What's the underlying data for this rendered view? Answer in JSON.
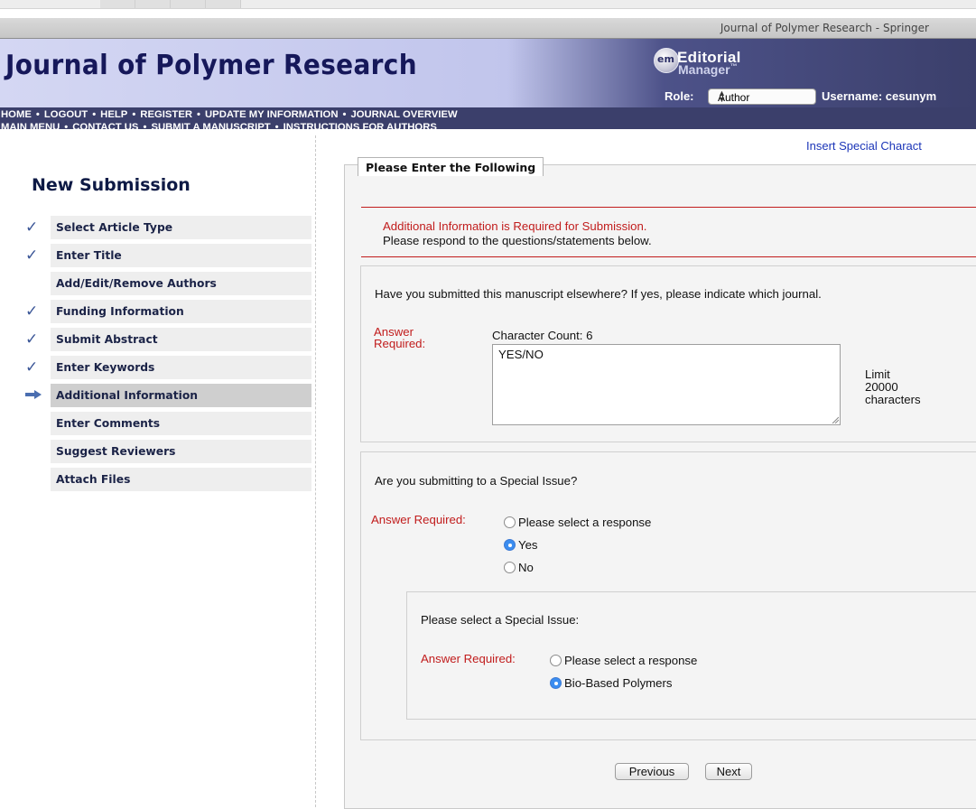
{
  "browser": {
    "site_name": "Journal of Polymer Research - Springer"
  },
  "header": {
    "journal_title": "Journal of Polymer Research",
    "logo": {
      "em": "em",
      "editorial": "Editorial",
      "manager": "Manager"
    },
    "nav_line1": [
      "HOME",
      "LOGOUT",
      "HELP",
      "REGISTER",
      "UPDATE MY INFORMATION",
      "JOURNAL OVERVIEW"
    ],
    "nav_line2": [
      "MAIN MENU",
      "CONTACT US",
      "SUBMIT A MANUSCRIPT",
      "INSTRUCTIONS FOR AUTHORS"
    ],
    "nav_separator": "•",
    "role_label": "Role:",
    "role_value": "Author",
    "username_text": "Username: cesunym"
  },
  "sidebar": {
    "title": "New Submission",
    "steps": [
      {
        "label": "Select Article Type",
        "status": "done"
      },
      {
        "label": "Enter Title",
        "status": "done"
      },
      {
        "label": "Add/Edit/Remove Authors",
        "status": "none"
      },
      {
        "label": "Funding Information",
        "status": "done"
      },
      {
        "label": "Submit Abstract",
        "status": "done"
      },
      {
        "label": "Enter Keywords",
        "status": "done"
      },
      {
        "label": "Additional Information",
        "status": "current"
      },
      {
        "label": "Enter Comments",
        "status": "none"
      },
      {
        "label": "Suggest Reviewers",
        "status": "none"
      },
      {
        "label": "Attach Files",
        "status": "none"
      }
    ]
  },
  "form": {
    "insert_special": "Insert Special Charact",
    "legend": "Please Enter the Following",
    "notice_line1": "Additional Information is Required for Submission.",
    "notice_line2": "Please respond to the questions/statements below.",
    "q1": {
      "text": "Have you submitted this manuscript elsewhere? If yes, please indicate which journal.",
      "required_label": "Answer Required:",
      "char_count": "Character Count: 6",
      "answer": "YES/NO",
      "limit_line1": "Limit",
      "limit_line2": "20000",
      "limit_line3": "characters"
    },
    "q2": {
      "text": "Are you submitting to a Special Issue?",
      "required_label": "Answer Required:",
      "options": [
        "Please select a response",
        "Yes",
        "No"
      ],
      "selected": 1
    },
    "q3": {
      "text": "Please select a Special Issue:",
      "required_label": "Answer Required:",
      "options": [
        "Please select a response",
        "Bio-Based Polymers"
      ],
      "selected": 1
    },
    "previous_label": "Previous",
    "next_label": "Next"
  },
  "colors": {
    "header_bg": "#3b3f6b",
    "required_red": "#c11c1c",
    "link_blue": "#1b35b8",
    "check_blue": "#3b5697",
    "radio_blue": "#3b8df0"
  }
}
